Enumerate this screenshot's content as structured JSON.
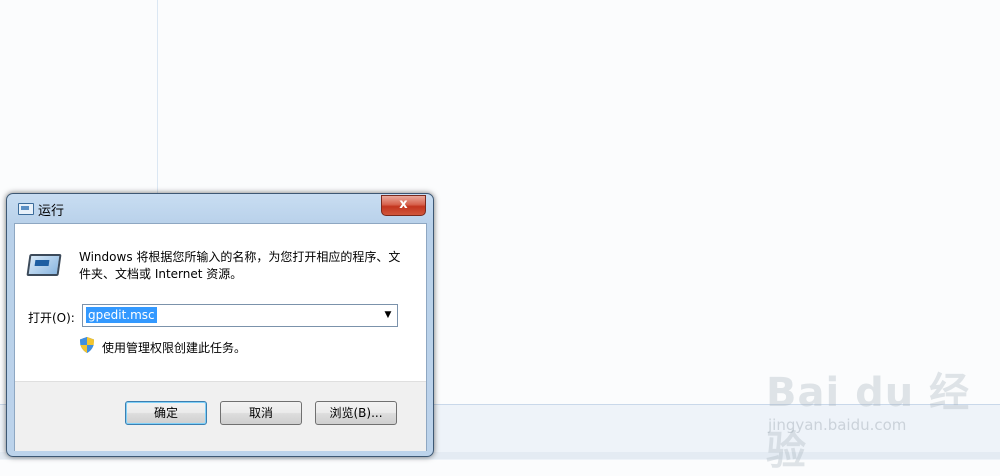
{
  "dialog": {
    "title": "运行",
    "close_glyph": "x",
    "description": "Windows 将根据您所输入的名称，为您打开相应的程序、文件夹、文档或 Internet 资源。",
    "open_label": "打开(O):",
    "open_value": "gpedit.msc",
    "dropdown_glyph": "▼",
    "admin_note": "使用管理权限创建此任务。",
    "buttons": {
      "ok": "确定",
      "cancel": "取消",
      "browse": "浏览(B)..."
    }
  },
  "watermark": {
    "logo_text": "Bai du 经验",
    "url": "jingyan.baidu.com"
  },
  "icons": {
    "title": "run-icon",
    "big": "run-program-icon",
    "shield": "uac-shield-icon",
    "close": "close-icon",
    "dropdown": "chevron-down-icon"
  }
}
